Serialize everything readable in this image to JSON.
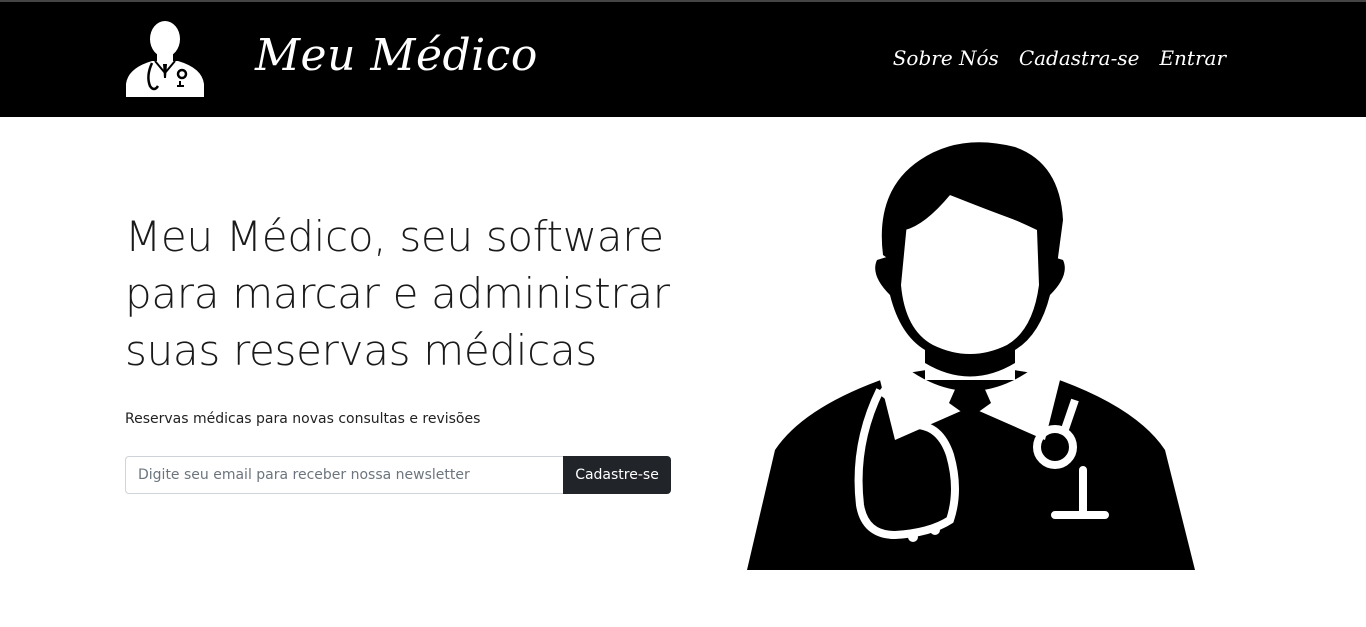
{
  "navbar": {
    "brand": "Meu Médico",
    "logo_icon": "doctor-avatar-icon",
    "links": [
      {
        "label": "Sobre Nós"
      },
      {
        "label": "Cadastra-se"
      },
      {
        "label": "Entrar"
      }
    ]
  },
  "hero": {
    "headline": "Meu Médico, seu software para marcar e administrar suas reservas médicas",
    "lead": "Reservas médicas para novas consultas e revisões",
    "newsletter": {
      "placeholder": "Digite seu email para receber nossa newsletter",
      "value": "",
      "button_label": "Cadastre-se"
    },
    "image_icon": "doctor-illustration-icon"
  },
  "colors": {
    "navbar_bg": "#000000",
    "button_bg": "#212529",
    "text": "#212529"
  }
}
